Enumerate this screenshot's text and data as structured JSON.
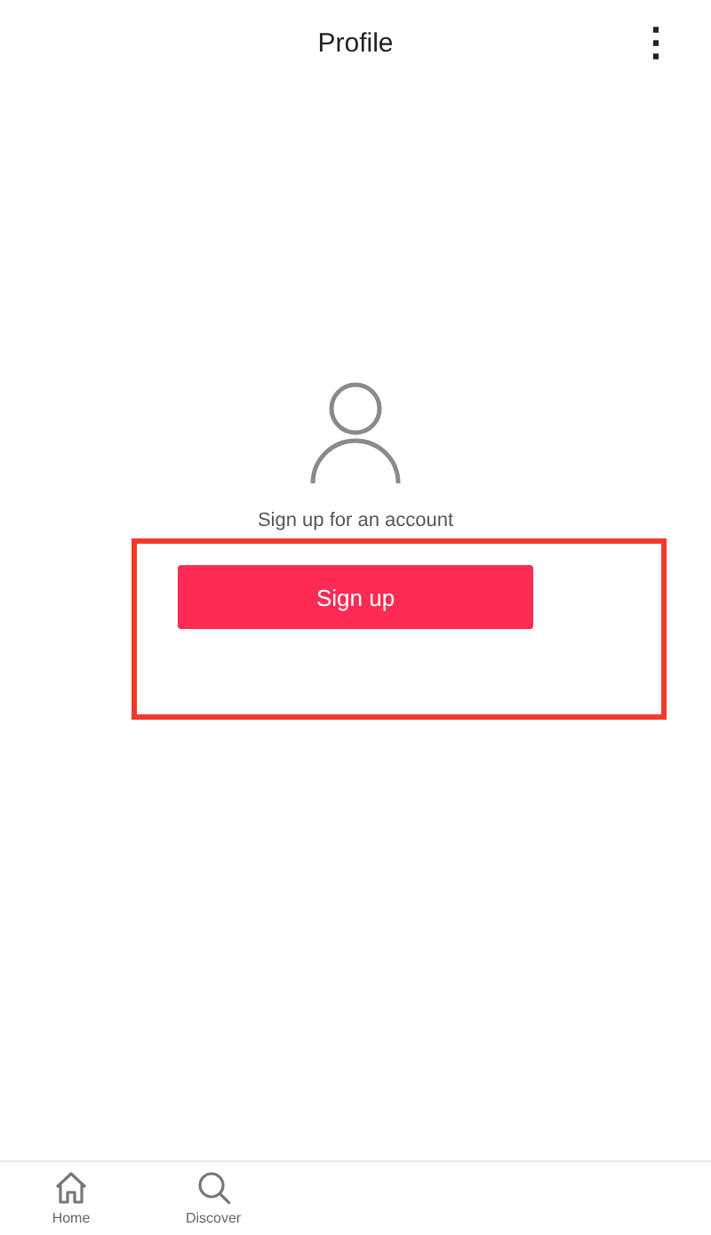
{
  "header": {
    "title": "Profile",
    "menu": "⋮"
  },
  "empty_state": {
    "message": "Sign up for an account",
    "button": "Sign up"
  },
  "tab_bar": [
    {
      "label": "Home",
      "kind": "home"
    },
    {
      "label": "Discover",
      "kind": "search"
    }
  ]
}
